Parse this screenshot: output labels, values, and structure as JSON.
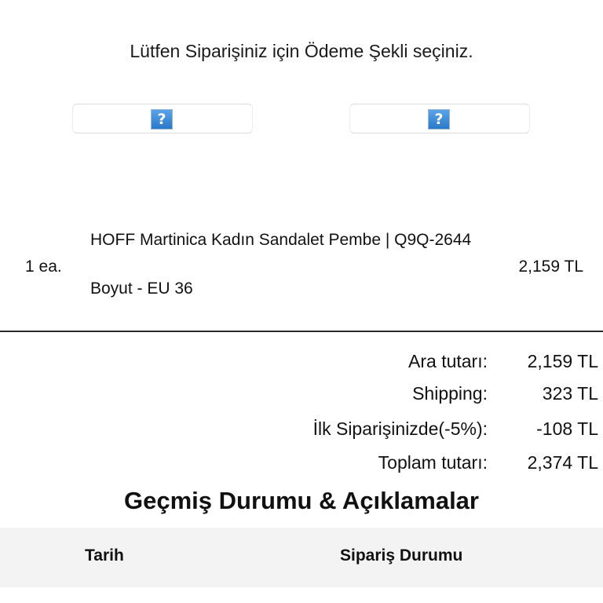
{
  "payment": {
    "prompt": "Lütfen Siparişiniz için Ödeme Şekli seçiniz.",
    "options": [
      {
        "icon": "broken-image-icon",
        "glyph": "?"
      },
      {
        "icon": "broken-image-icon",
        "glyph": "?"
      }
    ]
  },
  "item": {
    "qty": "1 ea.",
    "name": "HOFF Martinica Kadın Sandalet Pembe | Q9Q-2644",
    "size": "Boyut - EU 36",
    "price": "2,159 TL"
  },
  "summary": {
    "subtotal_label": "Ara tutarı:",
    "subtotal_value": "2,159 TL",
    "shipping_label": "Shipping:",
    "shipping_value": "323 TL",
    "discount_label": "İlk Siparişinizde(-5%):",
    "discount_value": "-108 TL",
    "total_label": "Toplam tutarı:",
    "total_value": "2,374 TL"
  },
  "history": {
    "title": "Geçmiş Durumu & Açıklamalar",
    "columns": [
      "Tarih",
      "Sipariş Durumu"
    ]
  },
  "colors": {
    "icon_blue": "#2a79c9",
    "header_bg": "#f3f3f3",
    "divider": "#2b2b2b"
  }
}
